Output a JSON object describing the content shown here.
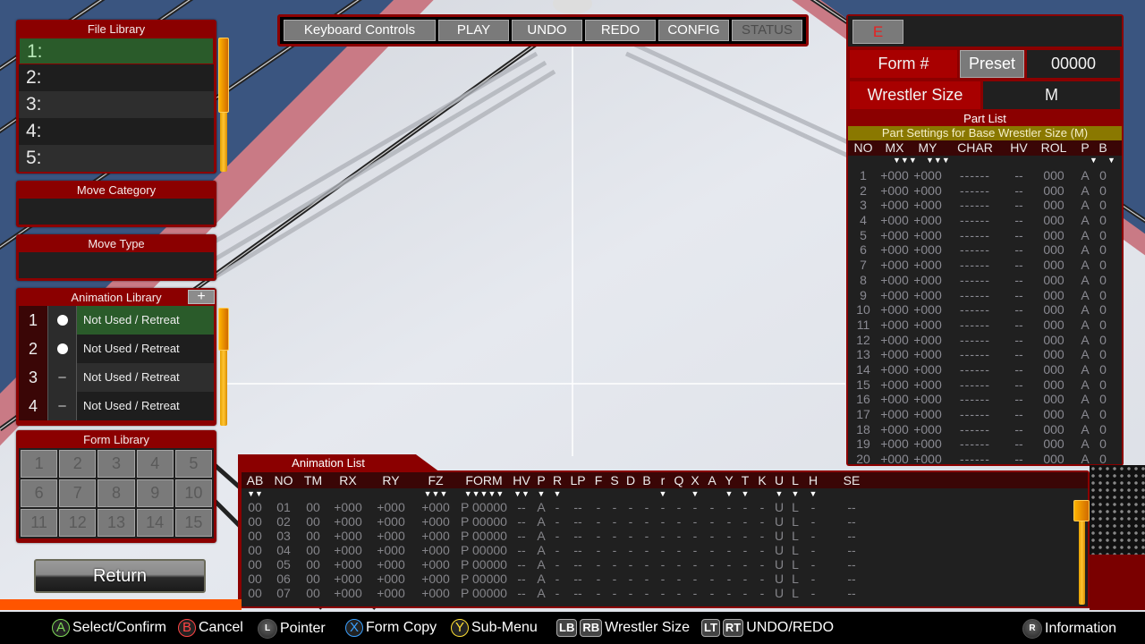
{
  "colors": {
    "panel_red": "#8b0000",
    "selected_green": "#2a5b2a",
    "scroll_orange": "#ffb300",
    "subtitle_olive": "#8a7800"
  },
  "file_library": {
    "title": "File Library",
    "items": [
      {
        "label": "1:",
        "selected": true
      },
      {
        "label": "2:"
      },
      {
        "label": "3:"
      },
      {
        "label": "4:"
      },
      {
        "label": "5:"
      }
    ]
  },
  "move_category": {
    "title": "Move Category",
    "value": ""
  },
  "move_type": {
    "title": "Move Type",
    "value": ""
  },
  "animation_library": {
    "title": "Animation Library",
    "add_label": "+",
    "items": [
      {
        "num": "1",
        "mark": "dot",
        "name": "Not Used / Retreat",
        "selected": true
      },
      {
        "num": "2",
        "mark": "dot",
        "name": "Not Used / Retreat"
      },
      {
        "num": "3",
        "mark": "–",
        "name": "Not Used / Retreat"
      },
      {
        "num": "4",
        "mark": "–",
        "name": "Not Used / Retreat"
      }
    ]
  },
  "form_library": {
    "title": "Form Library",
    "cells": [
      "1",
      "2",
      "3",
      "4",
      "5",
      "6",
      "7",
      "8",
      "9",
      "10",
      "11",
      "12",
      "13",
      "14",
      "15"
    ]
  },
  "return_label": "Return",
  "toolbar": {
    "buttons": [
      {
        "label": "Keyboard Controls",
        "enabled": true
      },
      {
        "label": "PLAY",
        "enabled": true
      },
      {
        "label": "UNDO",
        "enabled": true
      },
      {
        "label": "REDO",
        "enabled": true
      },
      {
        "label": "CONFIG",
        "enabled": true
      },
      {
        "label": "STATUS",
        "enabled": false
      }
    ]
  },
  "right_panel": {
    "e_label": "E",
    "form_label": "Form #",
    "preset_label": "Preset",
    "form_value": "00000",
    "size_label": "Wrestler Size",
    "size_value": "M",
    "part_list_title": "Part List",
    "part_subtitle": "Part Settings for Base Wrestler Size (M)",
    "columns": [
      "NO",
      "MX",
      "MY",
      "CHAR",
      "HV",
      "ROL",
      "P",
      "B"
    ],
    "rows": [
      {
        "no": "1",
        "mx": "+000",
        "my": "+000",
        "char": "------",
        "hv": "--",
        "rol": "000",
        "p": "A",
        "b": "0"
      },
      {
        "no": "2",
        "mx": "+000",
        "my": "+000",
        "char": "------",
        "hv": "--",
        "rol": "000",
        "p": "A",
        "b": "0"
      },
      {
        "no": "3",
        "mx": "+000",
        "my": "+000",
        "char": "------",
        "hv": "--",
        "rol": "000",
        "p": "A",
        "b": "0"
      },
      {
        "no": "4",
        "mx": "+000",
        "my": "+000",
        "char": "------",
        "hv": "--",
        "rol": "000",
        "p": "A",
        "b": "0"
      },
      {
        "no": "5",
        "mx": "+000",
        "my": "+000",
        "char": "------",
        "hv": "--",
        "rol": "000",
        "p": "A",
        "b": "0"
      },
      {
        "no": "6",
        "mx": "+000",
        "my": "+000",
        "char": "------",
        "hv": "--",
        "rol": "000",
        "p": "A",
        "b": "0"
      },
      {
        "no": "7",
        "mx": "+000",
        "my": "+000",
        "char": "------",
        "hv": "--",
        "rol": "000",
        "p": "A",
        "b": "0"
      },
      {
        "no": "8",
        "mx": "+000",
        "my": "+000",
        "char": "------",
        "hv": "--",
        "rol": "000",
        "p": "A",
        "b": "0"
      },
      {
        "no": "9",
        "mx": "+000",
        "my": "+000",
        "char": "------",
        "hv": "--",
        "rol": "000",
        "p": "A",
        "b": "0"
      },
      {
        "no": "10",
        "mx": "+000",
        "my": "+000",
        "char": "------",
        "hv": "--",
        "rol": "000",
        "p": "A",
        "b": "0"
      },
      {
        "no": "11",
        "mx": "+000",
        "my": "+000",
        "char": "------",
        "hv": "--",
        "rol": "000",
        "p": "A",
        "b": "0"
      },
      {
        "no": "12",
        "mx": "+000",
        "my": "+000",
        "char": "------",
        "hv": "--",
        "rol": "000",
        "p": "A",
        "b": "0"
      },
      {
        "no": "13",
        "mx": "+000",
        "my": "+000",
        "char": "------",
        "hv": "--",
        "rol": "000",
        "p": "A",
        "b": "0"
      },
      {
        "no": "14",
        "mx": "+000",
        "my": "+000",
        "char": "------",
        "hv": "--",
        "rol": "000",
        "p": "A",
        "b": "0"
      },
      {
        "no": "15",
        "mx": "+000",
        "my": "+000",
        "char": "------",
        "hv": "--",
        "rol": "000",
        "p": "A",
        "b": "0"
      },
      {
        "no": "16",
        "mx": "+000",
        "my": "+000",
        "char": "------",
        "hv": "--",
        "rol": "000",
        "p": "A",
        "b": "0"
      },
      {
        "no": "17",
        "mx": "+000",
        "my": "+000",
        "char": "------",
        "hv": "--",
        "rol": "000",
        "p": "A",
        "b": "0"
      },
      {
        "no": "18",
        "mx": "+000",
        "my": "+000",
        "char": "------",
        "hv": "--",
        "rol": "000",
        "p": "A",
        "b": "0"
      },
      {
        "no": "19",
        "mx": "+000",
        "my": "+000",
        "char": "------",
        "hv": "--",
        "rol": "000",
        "p": "A",
        "b": "0"
      },
      {
        "no": "20",
        "mx": "+000",
        "my": "+000",
        "char": "------",
        "hv": "--",
        "rol": "000",
        "p": "A",
        "b": "0"
      }
    ]
  },
  "animation_list": {
    "title": "Animation List",
    "columns": [
      "AB",
      "NO",
      "TM",
      "RX",
      "RY",
      "FZ",
      "FORM",
      "HV",
      "P",
      "R",
      "LP",
      "F",
      "S",
      "D",
      "B",
      "r",
      "Q",
      "X",
      "A",
      "Y",
      "T",
      "K",
      "U",
      "L",
      "H",
      "SE"
    ],
    "rows": [
      {
        "ab": "00",
        "no": "01",
        "tm": "00",
        "rx": "+000",
        "ry": "+000",
        "fz": "+000",
        "form": "P 00000",
        "hv": "--",
        "p": "A",
        "r": "-",
        "lp": "--",
        "f": "-",
        "s": "-",
        "d": "-",
        "b": "-",
        "r2": "-",
        "q": "-",
        "x": "-",
        "a": "-",
        "y": "-",
        "t": "-",
        "k": "-",
        "u": "U",
        "l": "L",
        "h": "-",
        "se": "--"
      },
      {
        "ab": "00",
        "no": "02",
        "tm": "00",
        "rx": "+000",
        "ry": "+000",
        "fz": "+000",
        "form": "P 00000",
        "hv": "--",
        "p": "A",
        "r": "-",
        "lp": "--",
        "f": "-",
        "s": "-",
        "d": "-",
        "b": "-",
        "r2": "-",
        "q": "-",
        "x": "-",
        "a": "-",
        "y": "-",
        "t": "-",
        "k": "-",
        "u": "U",
        "l": "L",
        "h": "-",
        "se": "--"
      },
      {
        "ab": "00",
        "no": "03",
        "tm": "00",
        "rx": "+000",
        "ry": "+000",
        "fz": "+000",
        "form": "P 00000",
        "hv": "--",
        "p": "A",
        "r": "-",
        "lp": "--",
        "f": "-",
        "s": "-",
        "d": "-",
        "b": "-",
        "r2": "-",
        "q": "-",
        "x": "-",
        "a": "-",
        "y": "-",
        "t": "-",
        "k": "-",
        "u": "U",
        "l": "L",
        "h": "-",
        "se": "--"
      },
      {
        "ab": "00",
        "no": "04",
        "tm": "00",
        "rx": "+000",
        "ry": "+000",
        "fz": "+000",
        "form": "P 00000",
        "hv": "--",
        "p": "A",
        "r": "-",
        "lp": "--",
        "f": "-",
        "s": "-",
        "d": "-",
        "b": "-",
        "r2": "-",
        "q": "-",
        "x": "-",
        "a": "-",
        "y": "-",
        "t": "-",
        "k": "-",
        "u": "U",
        "l": "L",
        "h": "-",
        "se": "--"
      },
      {
        "ab": "00",
        "no": "05",
        "tm": "00",
        "rx": "+000",
        "ry": "+000",
        "fz": "+000",
        "form": "P 00000",
        "hv": "--",
        "p": "A",
        "r": "-",
        "lp": "--",
        "f": "-",
        "s": "-",
        "d": "-",
        "b": "-",
        "r2": "-",
        "q": "-",
        "x": "-",
        "a": "-",
        "y": "-",
        "t": "-",
        "k": "-",
        "u": "U",
        "l": "L",
        "h": "-",
        "se": "--"
      },
      {
        "ab": "00",
        "no": "06",
        "tm": "00",
        "rx": "+000",
        "ry": "+000",
        "fz": "+000",
        "form": "P 00000",
        "hv": "--",
        "p": "A",
        "r": "-",
        "lp": "--",
        "f": "-",
        "s": "-",
        "d": "-",
        "b": "-",
        "r2": "-",
        "q": "-",
        "x": "-",
        "a": "-",
        "y": "-",
        "t": "-",
        "k": "-",
        "u": "U",
        "l": "L",
        "h": "-",
        "se": "--"
      },
      {
        "ab": "00",
        "no": "07",
        "tm": "00",
        "rx": "+000",
        "ry": "+000",
        "fz": "+000",
        "form": "P 00000",
        "hv": "--",
        "p": "A",
        "r": "-",
        "lp": "--",
        "f": "-",
        "s": "-",
        "d": "-",
        "b": "-",
        "r2": "-",
        "q": "-",
        "x": "-",
        "a": "-",
        "y": "-",
        "t": "-",
        "k": "-",
        "u": "U",
        "l": "L",
        "h": "-",
        "se": "--"
      }
    ]
  },
  "controls": [
    {
      "icon": "a-button-icon",
      "glyph": "A",
      "color": "#7ed957",
      "label": "Select/Confirm"
    },
    {
      "icon": "b-button-icon",
      "glyph": "B",
      "color": "#ff4444",
      "label": "Cancel"
    },
    {
      "icon": "left-stick-icon",
      "glyph": "L",
      "label": "Pointer"
    },
    {
      "icon": "x-button-icon",
      "glyph": "X",
      "color": "#3aa0ff",
      "label": "Form Copy"
    },
    {
      "icon": "y-button-icon",
      "glyph": "Y",
      "color": "#ffe033",
      "label": "Sub-Menu"
    },
    {
      "icon": "lb-rb-icon",
      "glyphs": [
        "LB",
        "RB"
      ],
      "label": "Wrestler Size"
    },
    {
      "icon": "lt-rt-icon",
      "glyphs": [
        "LT",
        "RT"
      ],
      "label": "UNDO/REDO"
    },
    {
      "icon": "right-stick-icon",
      "glyph": "R",
      "label": "Information"
    }
  ]
}
